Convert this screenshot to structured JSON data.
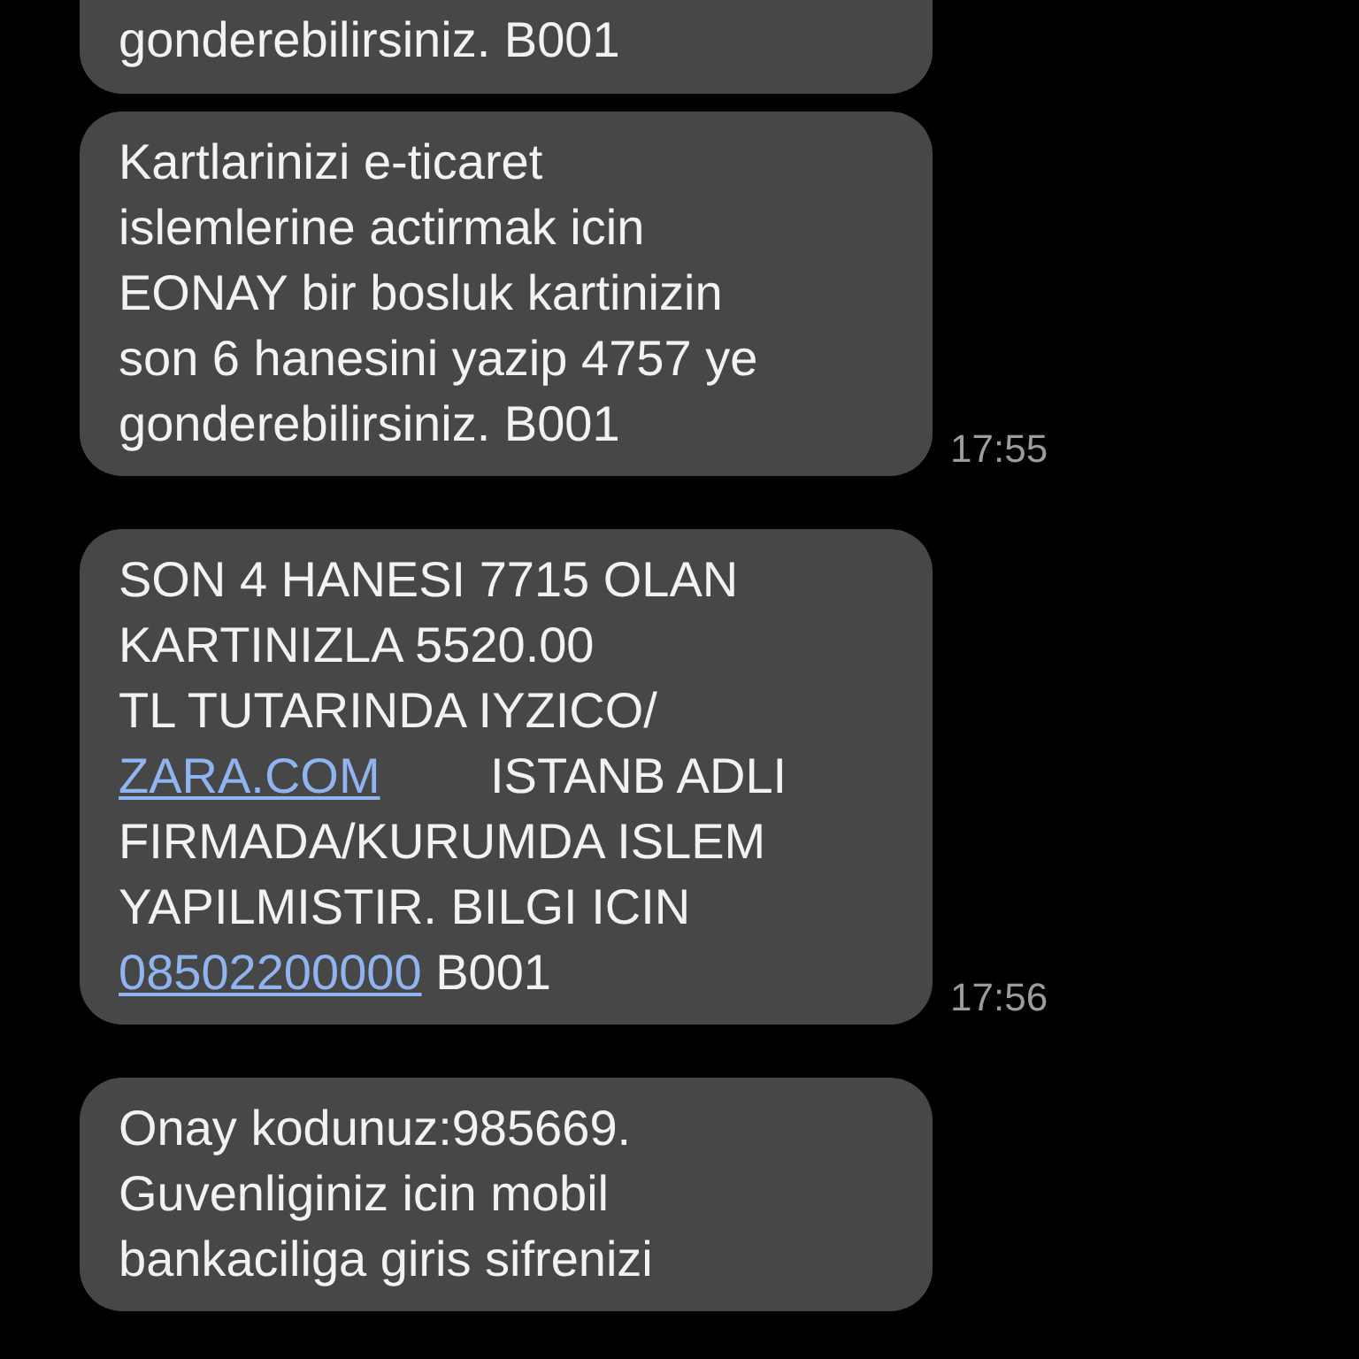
{
  "messages": [
    {
      "parts": [
        {
          "text": "gonderebilirsiniz. B001",
          "link": false
        }
      ]
    },
    {
      "parts": [
        {
          "text": "Kartlarinizi e-ticaret\nislemlerine actirmak icin\nEONAY bir bosluk kartinizin\nson 6 hanesini yazip 4757 ye\ngonderebilirsiniz. B001",
          "link": false
        }
      ],
      "time": "17:55"
    },
    {
      "parts": [
        {
          "text": "SON 4 HANESI 7715 OLAN\nKARTINIZLA 5520.00\nTL TUTARINDA IYZICO/\n",
          "link": false
        },
        {
          "text": "ZARA.COM",
          "link": true
        },
        {
          "text": "        ISTANB ADLI\nFIRMADA/KURUMDA ISLEM\nYAPILMISTIR. BILGI ICIN\n",
          "link": false
        },
        {
          "text": "08502200000",
          "link": true
        },
        {
          "text": " B001",
          "link": false
        }
      ],
      "time": "17:56"
    },
    {
      "parts": [
        {
          "text": "Onay kodunuz:985669.\nGuvenliginiz icin mobil\nbankaciliga giris sifrenizi",
          "link": false
        }
      ]
    }
  ]
}
